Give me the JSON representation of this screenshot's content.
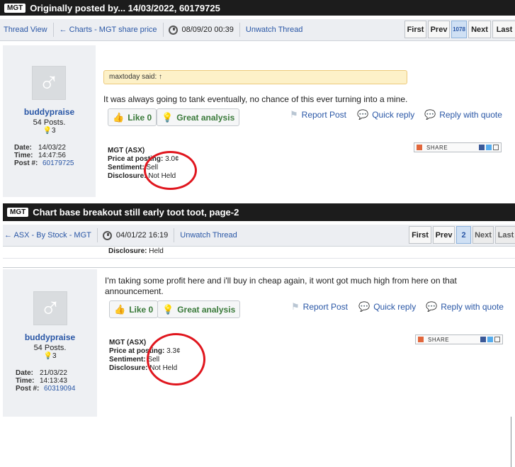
{
  "post1": {
    "header": {
      "tag": "MGT",
      "title": "Originally posted by... 14/03/2022, 60179725"
    },
    "nav": {
      "thread_view": "Thread View",
      "charts": "← Charts - MGT share price",
      "date": "08/09/20 00:39",
      "unwatch": "Unwatch Thread"
    },
    "pager": {
      "first": "First",
      "prev": "Prev",
      "current": "1078",
      "next": "Next",
      "last": "Last"
    },
    "user": {
      "name": "buddypraise",
      "posts": "54 Posts.",
      "likes": "3",
      "avatar_icon": "male-avatar-icon"
    },
    "meta": {
      "date_label": "Date:",
      "date": "14/03/22",
      "time_label": "Time:",
      "time": "14:47:56",
      "post_label": "Post #:",
      "post": "60179725"
    },
    "quote": "maxtoday said: ↑",
    "body": "It was always going to tank eventually, no chance of this ever turning into a mine.",
    "buttons": {
      "like": "Like 0",
      "great": "Great analysis"
    },
    "actions": {
      "report": "Report Post",
      "quick": "Quick reply",
      "reply_quote": "Reply with quote"
    },
    "stock": {
      "code": "MGT (ASX)",
      "price_label": "Price at posting:",
      "price": "3.0¢",
      "sentiment_label": "Sentiment:",
      "sentiment": "Sell",
      "disclosure_label": "Disclosure:",
      "disclosure": "Not Held"
    },
    "share": "SHARE"
  },
  "post2": {
    "header": {
      "tag": "MGT",
      "title": "Chart base breakout still early toot toot, page-2"
    },
    "nav": {
      "asx": "← ASX - By Stock - MGT",
      "date": "04/01/22 16:19",
      "unwatch": "Unwatch Thread"
    },
    "pager": {
      "first": "First",
      "prev": "Prev",
      "current": "2",
      "next": "Next",
      "last": "Last"
    },
    "prev_disclosure_label": "Disclosure:",
    "prev_disclosure": "Held",
    "user": {
      "name": "buddypraise",
      "posts": "54 Posts.",
      "likes": "3",
      "avatar_icon": "male-avatar-icon"
    },
    "meta": {
      "date_label": "Date:",
      "date": "21/03/22",
      "time_label": "Time:",
      "time": "14:13:43",
      "post_label": "Post #:",
      "post": "60319094"
    },
    "body": "I'm taking some profit here and i'll buy in cheap again, it wont got much high from here on that announcement.",
    "buttons": {
      "like": "Like 0",
      "great": "Great analysis"
    },
    "actions": {
      "report": "Report Post",
      "quick": "Quick reply",
      "reply_quote": "Reply with quote"
    },
    "stock": {
      "code": "MGT (ASX)",
      "price_label": "Price at posting:",
      "price": "3.3¢",
      "sentiment_label": "Sentiment:",
      "sentiment": "Sell",
      "disclosure_label": "Disclosure:",
      "disclosure": "Not Held"
    },
    "share": "SHARE"
  },
  "colors": {
    "link": "#2a57a6",
    "header_bg": "#1c1c1c",
    "annotation": "#e0161e",
    "quote_bg": "#fdf1c8"
  }
}
